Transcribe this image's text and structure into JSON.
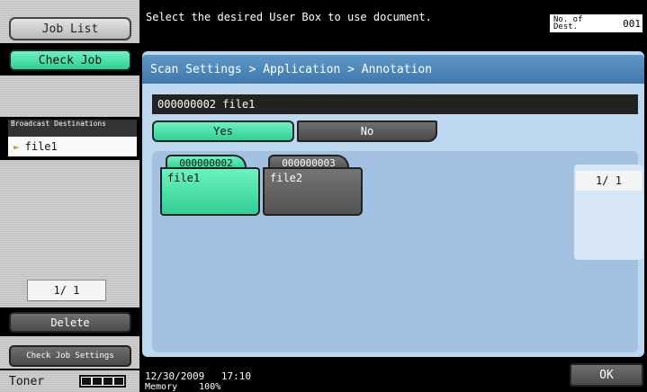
{
  "sidebar": {
    "job_list_label": "Job List",
    "check_job_label": "Check Job",
    "broadcast_heading": "Broadcast Destinations",
    "broadcast_item": "file1",
    "page_indicator": "1/  1",
    "delete_label": "Delete",
    "check_job_settings_label": "Check Job Settings",
    "toner_label": "Toner"
  },
  "header": {
    "message": "Select the desired User Box to use document.",
    "dest_label": "No. of Dest.",
    "dest_count": "001"
  },
  "panel": {
    "breadcrumb": "Scan Settings > Application > Annotation",
    "document_bar": "000000002  file1",
    "yes_label": "Yes",
    "no_label": "No",
    "folders": [
      {
        "number": "000000002",
        "name": "file1",
        "selected": true
      },
      {
        "number": "000000003",
        "name": "file2",
        "selected": false
      }
    ],
    "page_indicator": "1/  1"
  },
  "status": {
    "date": "12/30/2009",
    "time": "17:10",
    "memory_label": "Memory",
    "memory_value": "100%",
    "ok_label": "OK"
  },
  "colors": {
    "accent_green": "#3fdfa5",
    "panel_blue": "#bdd7ef",
    "title_blue": "#4a86bb"
  }
}
